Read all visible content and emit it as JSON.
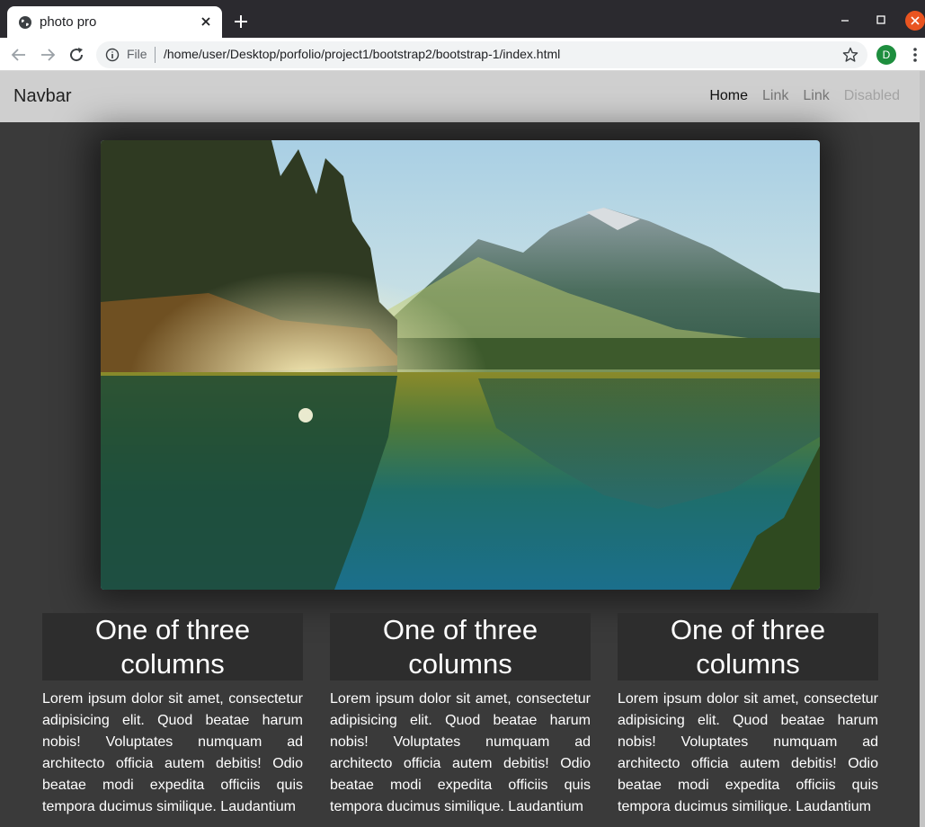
{
  "browser": {
    "tab_title": "photo pro",
    "url_scheme": "File",
    "url_path": "/home/user/Desktop/porfolio/project1/bootstrap2/bootstrap-1/index.html",
    "profile_initial": "D"
  },
  "navbar": {
    "brand": "Navbar",
    "links": [
      {
        "label": "Home",
        "state": "active"
      },
      {
        "label": "Link",
        "state": "normal"
      },
      {
        "label": "Link",
        "state": "normal"
      },
      {
        "label": "Disabled",
        "state": "disabled"
      }
    ]
  },
  "hero": {
    "icon": "landscape-photo"
  },
  "columns": [
    {
      "heading": "One of three columns",
      "text": "Lorem ipsum dolor sit amet, consectetur adipisicing elit. Quod beatae harum nobis! Voluptates numquam ad architecto officia autem debitis! Odio beatae modi expedita officiis quis tempora ducimus similique. Laudantium"
    },
    {
      "heading": "One of three columns",
      "text": "Lorem ipsum dolor sit amet, consectetur adipisicing elit. Quod beatae harum nobis! Voluptates numquam ad architecto officia autem debitis! Odio beatae modi expedita officiis quis tempora ducimus similique. Laudantium"
    },
    {
      "heading": "One of three columns",
      "text": "Lorem ipsum dolor sit amet, consectetur adipisicing elit. Quod beatae harum nobis! Voluptates numquam ad architecto officia autem debitis! Odio beatae modi expedita officiis quis tempora ducimus similique. Laudantium"
    }
  ],
  "colors": {
    "page_bg": "#3a3a3a",
    "navbar_bg": "#cfcfcf",
    "column_heading_bg": "#2d2d2d",
    "window_close": "#e95420"
  }
}
